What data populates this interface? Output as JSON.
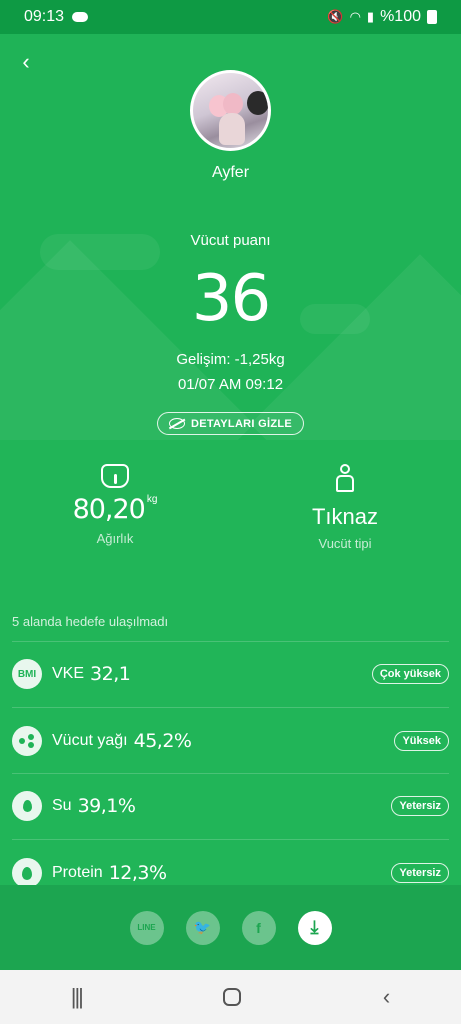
{
  "status": {
    "time": "09:13",
    "battery": "%100"
  },
  "profile": {
    "name": "Ayfer"
  },
  "score": {
    "label": "Vücut puanı",
    "value": "36"
  },
  "progress": {
    "text": "Gelişim: -1,25kg",
    "datetime": "01/07 AM 09:12"
  },
  "details_button": {
    "label": "DETAYLARI GİZLE"
  },
  "weight": {
    "value": "80,20",
    "unit": "kg",
    "label": "Ağırlık"
  },
  "body_type": {
    "value": "Tıknaz",
    "label": "Vucüt tipi"
  },
  "section_caption": "5 alanda hedefe ulaşılmadı",
  "rows": [
    {
      "icon": "BMI",
      "label": "VKE",
      "value": "32,1",
      "status": "Çok yüksek"
    },
    {
      "label": "Vücut yağı",
      "value": "45,2%",
      "status": "Yüksek"
    },
    {
      "label": "Su",
      "value": "39,1%",
      "status": "Yetersiz"
    },
    {
      "label": "Protein",
      "value": "12,3%",
      "status": "Yetersiz"
    }
  ],
  "share": {
    "line_label": "LINE"
  },
  "colors": {
    "primary": "#21b558",
    "dark": "#0e9a44",
    "share_bar": "#1ca550",
    "nav_bg": "#f3f3f3"
  },
  "icons": [
    "back-arrow-icon",
    "eye-slash-icon",
    "scale-icon",
    "body-type-icon",
    "drop-icon",
    "share-icon"
  ]
}
